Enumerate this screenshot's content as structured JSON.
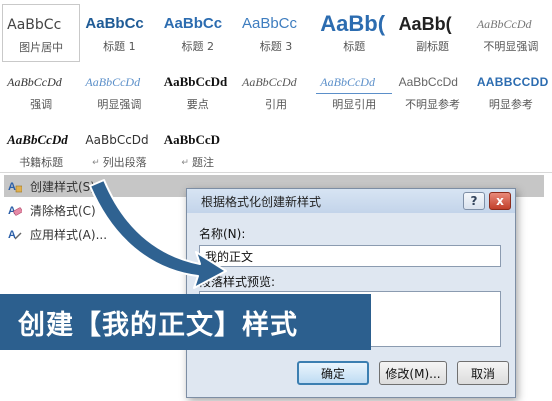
{
  "gallery": {
    "styles": [
      {
        "preview": "AaBbCc",
        "label": "图片居中",
        "kind": "s-normal"
      },
      {
        "preview": "AaBbCc",
        "label": "标题 1",
        "kind": "s-h1"
      },
      {
        "preview": "AaBbCc",
        "label": "标题 2",
        "kind": "s-h2"
      },
      {
        "preview": "AaBbCc",
        "label": "标题 3",
        "kind": "s-h3"
      },
      {
        "preview": "AaBb(",
        "label": "标题",
        "kind": "s-title"
      },
      {
        "preview": "AaBb(",
        "label": "副标题",
        "kind": "s-subtitle"
      },
      {
        "preview": "AaBbCcDd",
        "label": "不明显强调",
        "kind": "s-subtle"
      },
      {
        "preview": "AaBbCcDd",
        "label": "强调",
        "kind": "s-emph"
      },
      {
        "preview": "AaBbCcDd",
        "label": "明显强调",
        "kind": "s-intense"
      },
      {
        "preview": "AaBbCcDd",
        "label": "要点",
        "kind": "s-strong"
      },
      {
        "preview": "AaBbCcDd",
        "label": "引用",
        "kind": "s-quote"
      },
      {
        "preview": "AaBbCcDd",
        "label": "明显引用",
        "kind": "s-iquote"
      },
      {
        "preview": "AaBbCcDd",
        "label": "不明显参考",
        "kind": "s-sref"
      },
      {
        "preview": "AABBCCDD",
        "label": "明显参考",
        "kind": "s-iref"
      },
      {
        "preview": "AaBbCcDd",
        "label": "书籍标题",
        "kind": "s-book"
      },
      {
        "preview": "AaBbCcDd",
        "label": "列出段落",
        "kind": "s-list",
        "mark": "↵"
      },
      {
        "preview": "AaBbCcD",
        "label": "题注",
        "kind": "s-caption",
        "mark": "↵"
      }
    ]
  },
  "menu": {
    "create_style": "创建样式(S)",
    "clear_format": "清除格式(C)",
    "apply_styles": "应用样式(A)..."
  },
  "dialog": {
    "title": "根据格式化创建新样式",
    "help": "?",
    "close": "x",
    "name_label": "名称(N):",
    "name_value": "我的正文",
    "preview_label": "段落样式预览:",
    "ok": "确定",
    "modify": "修改(M)...",
    "cancel": "取消"
  },
  "banner": {
    "text": "创建【我的正文】样式"
  },
  "colors": {
    "banner_bg": "#2c5f8e",
    "arrow": "#2f6291",
    "menu_hover": "#c6c6c6"
  }
}
